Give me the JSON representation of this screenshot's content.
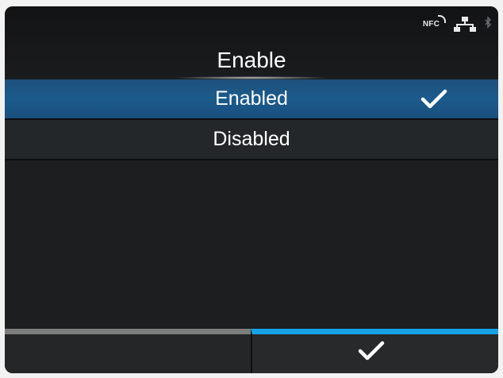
{
  "screen": {
    "title": "Enable",
    "status_icons": [
      "nfc-icon",
      "network-icon",
      "bluetooth-icon"
    ],
    "nfc_label": "NFC"
  },
  "options": [
    {
      "label": "Enabled",
      "selected": true
    },
    {
      "label": "Disabled",
      "selected": false
    }
  ],
  "bottom_bar": {
    "left_button_icon": "",
    "right_button_icon": "check-icon"
  },
  "colors": {
    "selected_row": "#1b5b8d",
    "confirm_accent": "#16a3e6",
    "left_accent": "#7d7d7d"
  }
}
